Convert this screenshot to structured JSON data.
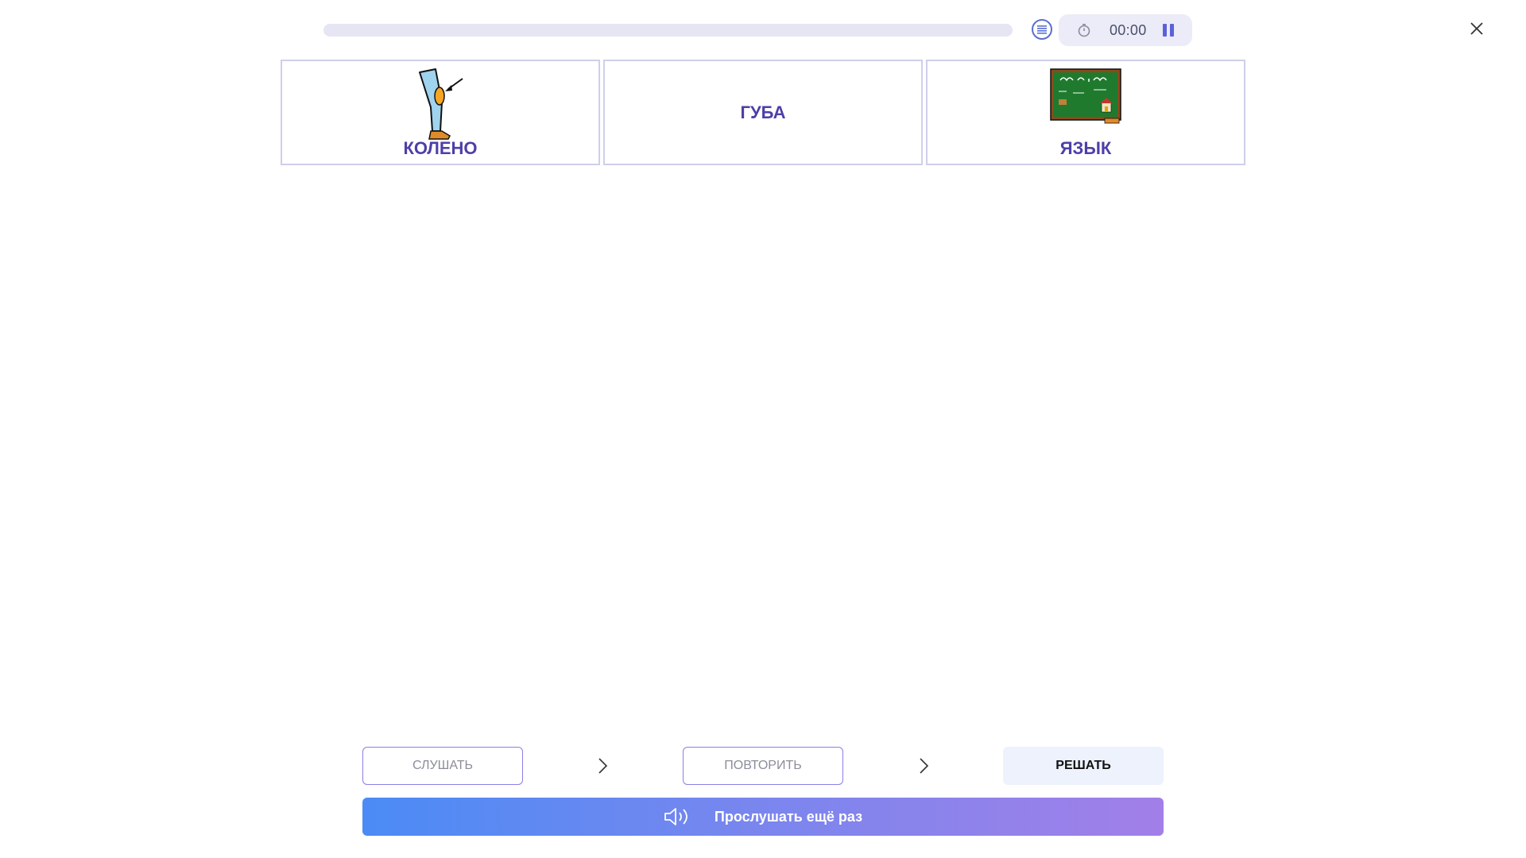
{
  "header": {
    "progress_percent": 0,
    "timer": "00:00",
    "icons": {
      "list": "list-icon",
      "stopwatch": "stopwatch-icon",
      "pause": "pause-icon",
      "close": "close-icon"
    }
  },
  "cards": [
    {
      "label": "КОЛЕНО",
      "image": "knee-picture"
    },
    {
      "label": "ГУБА",
      "image": null
    },
    {
      "label": "ЯЗЫК",
      "image": "chalkboard-picture"
    }
  ],
  "steps": {
    "listen": "СЛУШАТЬ",
    "repeat": "ПОВТОРИТЬ",
    "solve": "РЕШАТЬ"
  },
  "replay": {
    "label": "Прослушать ещё раз",
    "icon": "speaker-icon"
  },
  "colors": {
    "accent": "#5b62d8",
    "card_text": "#4d3fa8",
    "card_border": "#cfcfea",
    "gradient_start": "#4b8bf5",
    "gradient_end": "#a27fe8"
  }
}
